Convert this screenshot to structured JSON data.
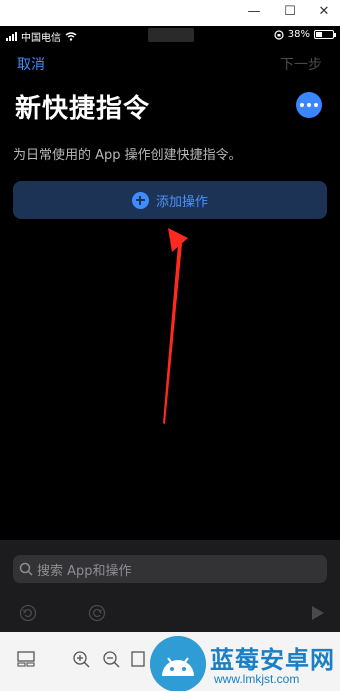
{
  "status_bar": {
    "carrier": "中国电信",
    "battery": "38%"
  },
  "nav": {
    "cancel_label": "取消",
    "next_label": "下一步"
  },
  "header": {
    "title": "新快捷指令"
  },
  "subtitle": "为日常使用的 App 操作创建快捷指令。",
  "add_action_label": "添加操作",
  "search": {
    "placeholder": "搜索 App和操作"
  },
  "watermark": {
    "title": "蓝莓安卓网",
    "url": "www.lmkjst.com"
  },
  "colors": {
    "accent": "#3f8cff",
    "button_bg": "#1d3355",
    "annotation_arrow": "#ff2a1f"
  },
  "icons": [
    "wifi-icon",
    "lock-rotation-icon",
    "more-icon",
    "plus-icon",
    "search-icon",
    "undo-icon",
    "redo-icon",
    "play-icon",
    "zoom-in-icon",
    "zoom-out-icon"
  ]
}
